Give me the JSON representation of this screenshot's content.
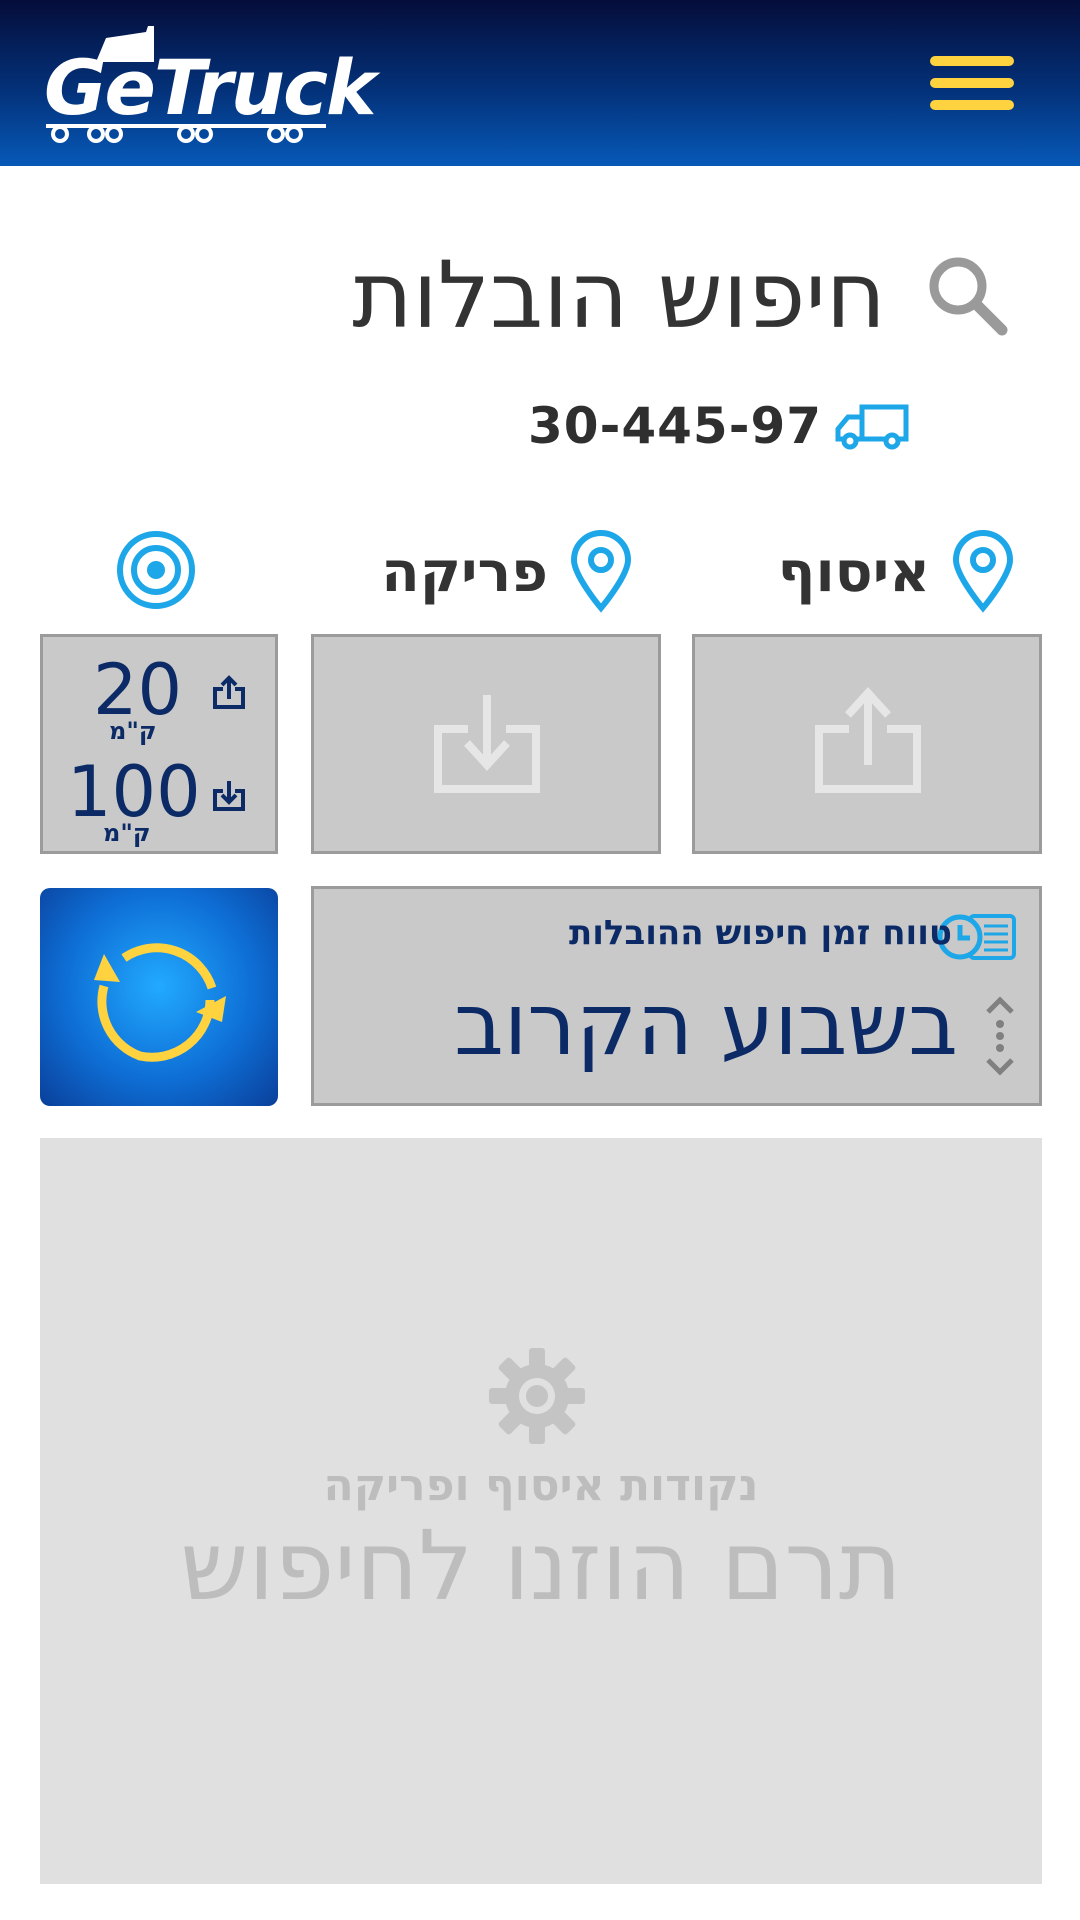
{
  "header": {
    "logo_text": "GeTruck",
    "menu_label": "menu"
  },
  "page": {
    "title": "חיפוש הובלות",
    "plate_number": "30-445-97"
  },
  "columns": {
    "pickup_label": "איסוף",
    "dropoff_label": "פריקה"
  },
  "distance": {
    "pickup_radius": "20",
    "dropoff_radius": "100",
    "unit": "ק\"מ"
  },
  "time_range": {
    "label": "טווח זמן חיפוש ההובלות",
    "value": "בשבוע הקרוב"
  },
  "results": {
    "line1": "נקודות איסוף ופריקה",
    "line2": "תרם הוזנו לחיפוש"
  },
  "colors": {
    "header_dark": "#050d3a",
    "header_light": "#0659b8",
    "accent_yellow": "#ffd23f",
    "icon_blue": "#1ea7e8",
    "text_navy": "#0b2a66",
    "box_gray": "#c9c9c9"
  }
}
